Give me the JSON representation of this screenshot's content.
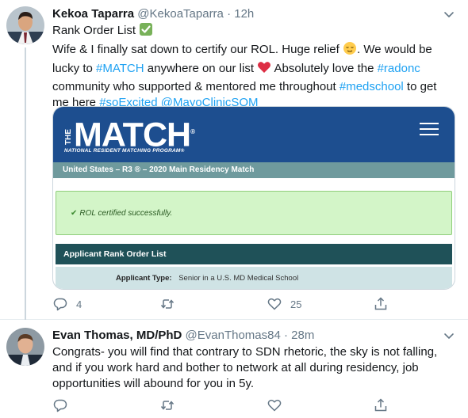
{
  "tweet1": {
    "name": "Kekoa Taparra",
    "handle": "@KekoaTaparra",
    "dot": "·",
    "time": "12h",
    "line1": "Rank Order List",
    "line1_emoji": "check-mark-button",
    "line2_a": "Wife & I finally sat down to certify our ROL. Huge relief ",
    "line2_emoji": "relieved-face",
    "line2_b": ". We would be",
    "line3_a": "lucky to ",
    "line3_link1": "#MATCH",
    "line3_b": " anywhere on our list ",
    "line3_emoji": "red-heart",
    "line3_c": " Absolutely love the ",
    "line3_link2": "#radonc",
    "line4_a": " community who supported & mentored me throughout ",
    "line4_link": "#medschool",
    "line4_b": " to get",
    "line5_a": "me here ",
    "line5_link1": "#soExcited",
    "line5_space": " ",
    "line5_link2": "@MayoClinicSOM",
    "card": {
      "logo_the": "THE",
      "logo_match": "MATCH",
      "logo_reg": "®",
      "logo_sub": "NATIONAL RESIDENT MATCHING PROGRAM®",
      "bar": "United States  –  R3 ®  –  2020 Main Residency Match",
      "success_check": "✔",
      "success": "ROL certified successfully.",
      "rol_header": "Applicant Rank Order List",
      "applicant_type_label": "Applicant Type:",
      "applicant_type_value": "Senior in a U.S. MD Medical School"
    },
    "replies": "4",
    "retweets": "",
    "likes": "25"
  },
  "tweet2": {
    "name": "Evan Thomas, MD/PhD",
    "handle": "@EvanThomas84",
    "dot": "·",
    "time": "28m",
    "line1": "Congrats- you will find that contrary to SDN rhetoric, the sky is not falling,",
    "line2": "and if you work hard and bother to network at all during residency, job",
    "line3": "opportunities will abound for you in 5y."
  },
  "colors": {
    "link": "#1da1f2",
    "muted": "#657786",
    "match_blue": "#1d4e8f",
    "match_teal_bar": "#6f9a9d",
    "rol_header": "#1f5158",
    "success_bg": "#d3f5c8"
  }
}
